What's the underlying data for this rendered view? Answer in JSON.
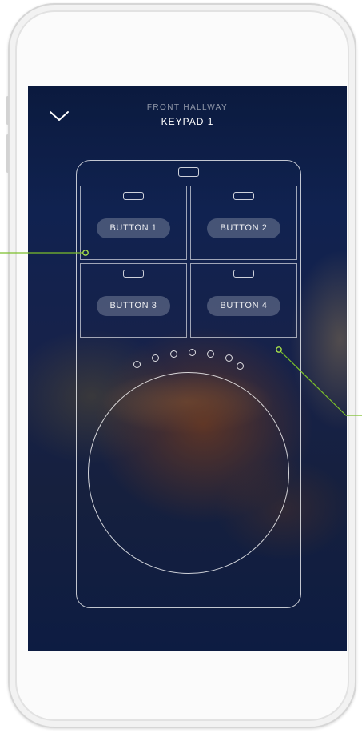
{
  "header": {
    "subtitle": "FRONT HALLWAY",
    "title": "KEYPAD 1",
    "back_icon": "chevron-down-icon"
  },
  "keypad": {
    "buttons": [
      {
        "label": "BUTTON 1"
      },
      {
        "label": "BUTTON 2"
      },
      {
        "label": "BUTTON 3"
      },
      {
        "label": "BUTTON 4"
      }
    ],
    "indicator_count": 7,
    "dial_icon": "dial-circle"
  },
  "colors": {
    "callout": "#7bbf2a",
    "outline": "#ffffff",
    "background_top": "#0b1a3e"
  }
}
